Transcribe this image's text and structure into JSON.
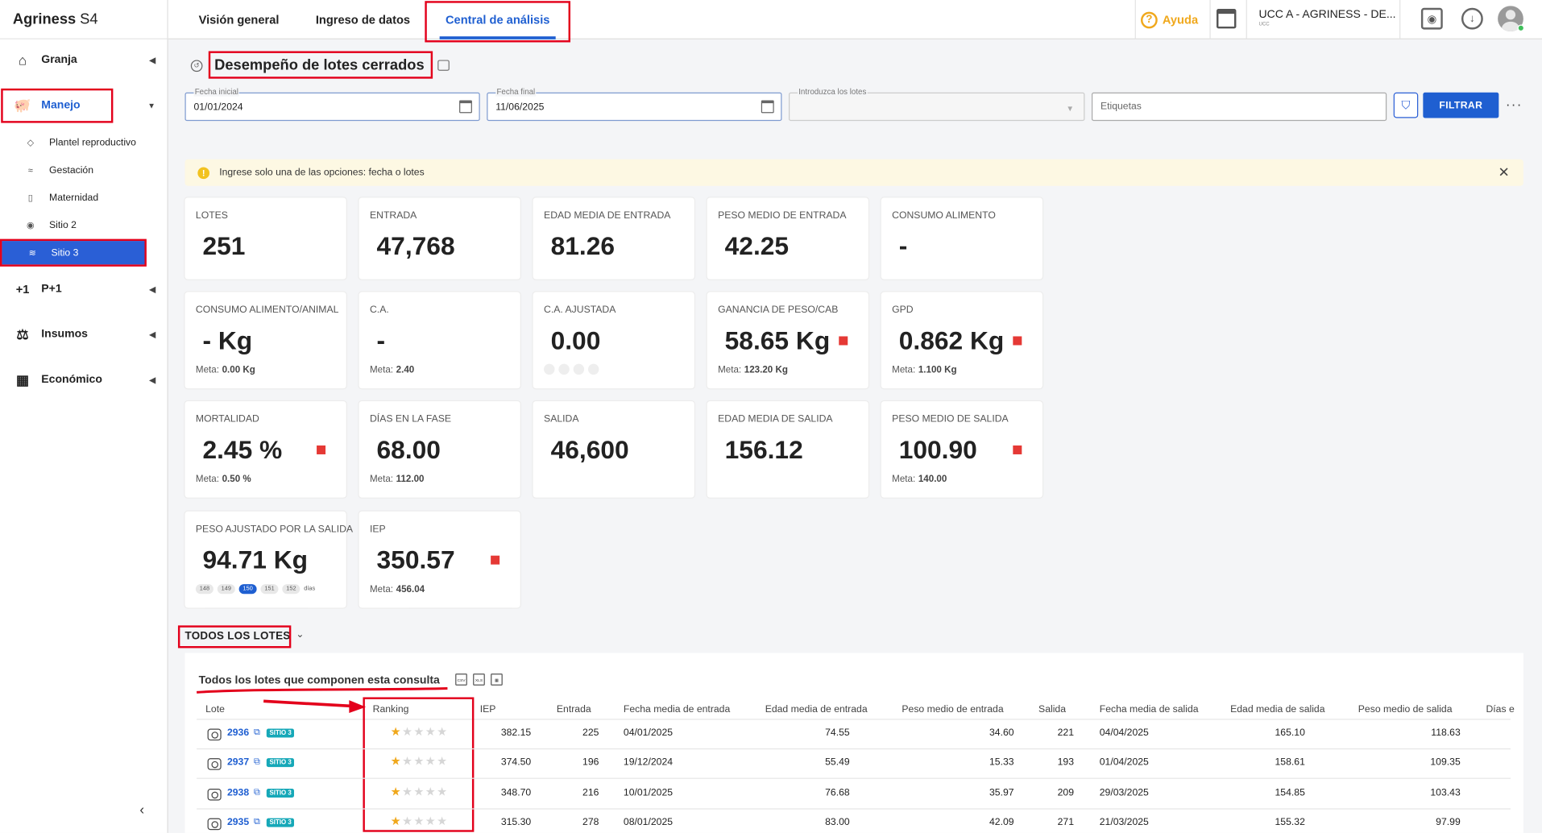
{
  "app": {
    "brand_bold": "Agriness",
    "brand_rest": "S4"
  },
  "sidebar": {
    "items": [
      {
        "label": "Granja",
        "icon": "home-icon"
      },
      {
        "label": "Manejo",
        "icon": "pig-icon"
      },
      {
        "label": "P+1",
        "icon": "plus-one-icon"
      },
      {
        "label": "Insumos",
        "icon": "scale-icon"
      },
      {
        "label": "Económico",
        "icon": "calculator-icon"
      }
    ],
    "subitems": [
      {
        "label": "Plantel reproductivo"
      },
      {
        "label": "Gestación"
      },
      {
        "label": "Maternidad"
      },
      {
        "label": "Sitio 2"
      },
      {
        "label": "Sitio 3"
      }
    ]
  },
  "tabs": [
    {
      "label": "Visión general"
    },
    {
      "label": "Ingreso de datos"
    },
    {
      "label": "Central de análisis"
    }
  ],
  "topbar": {
    "help": "Ayuda",
    "farm": "UCC A - AGRINESS - DE...",
    "farm_sub": "UCC"
  },
  "page": {
    "title": "Desempeño de lotes cerrados"
  },
  "filters": {
    "start_label": "Fecha inicial",
    "start_value": "01/01/2024",
    "end_label": "Fecha final",
    "end_value": "11/06/2025",
    "lots_label": "Introduzca los lotes",
    "tags_placeholder": "Etiquetas",
    "button": "FILTRAR"
  },
  "alert": {
    "message": "Ingrese solo una de las opciones: fecha o lotes"
  },
  "cards": [
    {
      "title": "LOTES",
      "value": "251"
    },
    {
      "title": "ENTRADA",
      "value": "47,768"
    },
    {
      "title": "EDAD MEDIA DE ENTRADA",
      "value": "81.26"
    },
    {
      "title": "PESO MEDIO DE ENTRADA",
      "value": "42.25"
    },
    {
      "title": "CONSUMO ALIMENTO",
      "value": "-"
    },
    {
      "title": "CONSUMO ALIMENTO/ANIMAL",
      "value": "- Kg",
      "meta_label": "Meta:",
      "meta_value": "0.00 Kg"
    },
    {
      "title": "C.A.",
      "value": "-",
      "meta_label": "Meta:",
      "meta_value": "2.40"
    },
    {
      "title": "C.A. AJUSTADA",
      "value": "0.00"
    },
    {
      "title": "GANANCIA DE PESO/CAB",
      "value": "58.65 Kg",
      "meta_label": "Meta:",
      "meta_value": "123.20 Kg"
    },
    {
      "title": "GPD",
      "value": "0.862 Kg",
      "meta_label": "Meta:",
      "meta_value": "1.100 Kg"
    },
    {
      "title": "MORTALIDAD",
      "value": "2.45 %",
      "meta_label": "Meta:",
      "meta_value": "0.50 %"
    },
    {
      "title": "DÍAS EN LA FASE",
      "value": "68.00",
      "meta_label": "Meta:",
      "meta_value": "112.00"
    },
    {
      "title": "SALIDA",
      "value": "46,600"
    },
    {
      "title": "EDAD MEDIA DE SALIDA",
      "value": "156.12"
    },
    {
      "title": "PESO MEDIO DE SALIDA",
      "value": "100.90",
      "meta_label": "Meta:",
      "meta_value": "140.00"
    },
    {
      "title": "PESO AJUSTADO POR LA SALIDA",
      "value": "94.71 Kg"
    },
    {
      "title": "IEP",
      "value": "350.57",
      "meta_label": "Meta:",
      "meta_value": "456.04"
    }
  ],
  "day_pills": [
    "148",
    "149",
    "150",
    "151",
    "152"
  ],
  "day_pills_unit": "días",
  "section": {
    "title": "TODOS LOS LOTES",
    "table_title": "Todos los lotes que componen esta consulta"
  },
  "table": {
    "columns": [
      "Lote",
      "Ranking",
      "IEP",
      "Entrada",
      "Fecha media de entrada",
      "Edad media de entrada",
      "Peso medio de entrada",
      "Salida",
      "Fecha media de salida",
      "Edad media de salida",
      "Peso medio de salida",
      "Días e"
    ],
    "rows": [
      {
        "lote": "2936",
        "tag": "SITIO 3",
        "stars": 1,
        "iep": "382.15",
        "entrada": "225",
        "fecha_entrada": "04/01/2025",
        "edad_entrada": "74.55",
        "peso_entrada": "34.60",
        "salida": "221",
        "fecha_salida": "04/04/2025",
        "edad_salida": "165.10",
        "peso_salida": "118.63"
      },
      {
        "lote": "2937",
        "tag": "SITIO 3",
        "stars": 1,
        "iep": "374.50",
        "entrada": "196",
        "fecha_entrada": "19/12/2024",
        "edad_entrada": "55.49",
        "peso_entrada": "15.33",
        "salida": "193",
        "fecha_salida": "01/04/2025",
        "edad_salida": "158.61",
        "peso_salida": "109.35"
      },
      {
        "lote": "2938",
        "tag": "SITIO 3",
        "stars": 1,
        "iep": "348.70",
        "entrada": "216",
        "fecha_entrada": "10/01/2025",
        "edad_entrada": "76.68",
        "peso_entrada": "35.97",
        "salida": "209",
        "fecha_salida": "29/03/2025",
        "edad_salida": "154.85",
        "peso_salida": "103.43"
      },
      {
        "lote": "2935",
        "tag": "SITIO 3",
        "stars": 1,
        "iep": "315.30",
        "entrada": "278",
        "fecha_entrada": "08/01/2025",
        "edad_entrada": "83.00",
        "peso_entrada": "42.09",
        "salida": "271",
        "fecha_salida": "21/03/2025",
        "edad_salida": "155.32",
        "peso_salida": "97.99"
      }
    ]
  },
  "colors": {
    "accent": "#1f5fd1",
    "flag": "#e53935",
    "annotation": "#e3001b",
    "star": "#f0a81c",
    "tag": "#16a8b8"
  }
}
